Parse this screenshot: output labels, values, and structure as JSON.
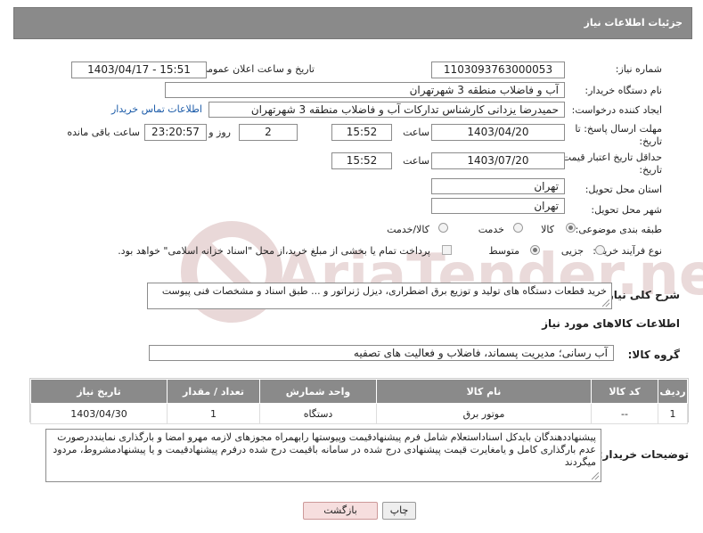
{
  "header": {
    "title": "جزئیات اطلاعات نیاز"
  },
  "fields": {
    "need_number_label": "شماره نیاز:",
    "need_number": "1103093763000053",
    "announce_label": "تاریخ و ساعت اعلان عمومی:",
    "announce_value": "1403/04/17 - 15:51",
    "buyer_org_label": "نام دستگاه خریدار:",
    "buyer_org": "آب و فاضلاب منطقه 3 شهرتهران",
    "creator_label": "ایجاد کننده درخواست:",
    "creator": "حمیدرضا یزدانی کارشناس تدارکات آب و فاضلاب منطقه 3 شهرتهران",
    "contact_link": "اطلاعات تماس خریدار",
    "reply_deadline_label": "مهلت ارسال پاسخ: تا",
    "reply_deadline_label2": "تاریخ:",
    "reply_date": "1403/04/20",
    "time_label": "ساعت",
    "reply_time": "15:52",
    "days_value": "2",
    "days_label": "روز و",
    "remaining_time": "23:20:57",
    "remaining_label": "ساعت باقی مانده",
    "price_valid_label": "حداقل تاریخ اعتبار قیمت: تا",
    "price_valid_label2": "تاریخ:",
    "price_valid_date": "1403/07/20",
    "price_valid_time": "15:52",
    "province_label": "استان محل تحویل:",
    "province": "تهران",
    "city_label": "شهر محل تحویل:",
    "city": "تهران",
    "category_label": "طبقه بندی موضوعی:",
    "cat_goods": "کالا",
    "cat_service": "خدمت",
    "cat_goods_service": "کالا/خدمت",
    "process_label": "نوع فرآیند خرید :",
    "proc_minor": "جزیی",
    "proc_medium": "متوسط",
    "payment_note": "پرداخت تمام یا بخشی از مبلغ خرید،از محل \"اسناد خزانه اسلامی\" خواهد بود."
  },
  "description": {
    "label": "شرح کلی نیاز:",
    "text": "خرید قطعات دستگاه های تولید و توزیع برق اضطراری، دیزل ژنراتور و ... طبق اسناد و مشخصات فنی پیوست"
  },
  "goods_section": {
    "title": "اطلاعات کالاهای مورد نیاز",
    "group_label": "گروه کالا:",
    "group_value": "آب رسانی؛ مدیریت پسماند، فاضلاب و فعالیت های تصفیه"
  },
  "table": {
    "headers": [
      "ردیف",
      "کد کالا",
      "نام کالا",
      "واحد شمارش",
      "تعداد / مقدار",
      "تاریخ نیاز"
    ],
    "rows": [
      [
        "1",
        "--",
        "موتور برق",
        "دستگاه",
        "1",
        "1403/04/30"
      ]
    ]
  },
  "buyer_notes": {
    "label": "توضیحات خریدار:",
    "text": "پیشنهاددهندگان بایدکل اسناداستعلام شامل فرم پیشنهادقیمت وپیوستها رابهمراه مجوزهای لازمه مهرو امضا و بارگذاری نماینددرصورت عدم بارگذاری کامل و یامغایرت قیمت پیشنهادی درج شده در سامانه باقیمت درج شده درفرم پیشنهادقیمت و یا پیشنهادمشروط، مردود میگردند"
  },
  "buttons": {
    "print": "چاپ",
    "back": "بازگشت"
  },
  "watermark": {
    "text": "AriaTender.neT"
  }
}
